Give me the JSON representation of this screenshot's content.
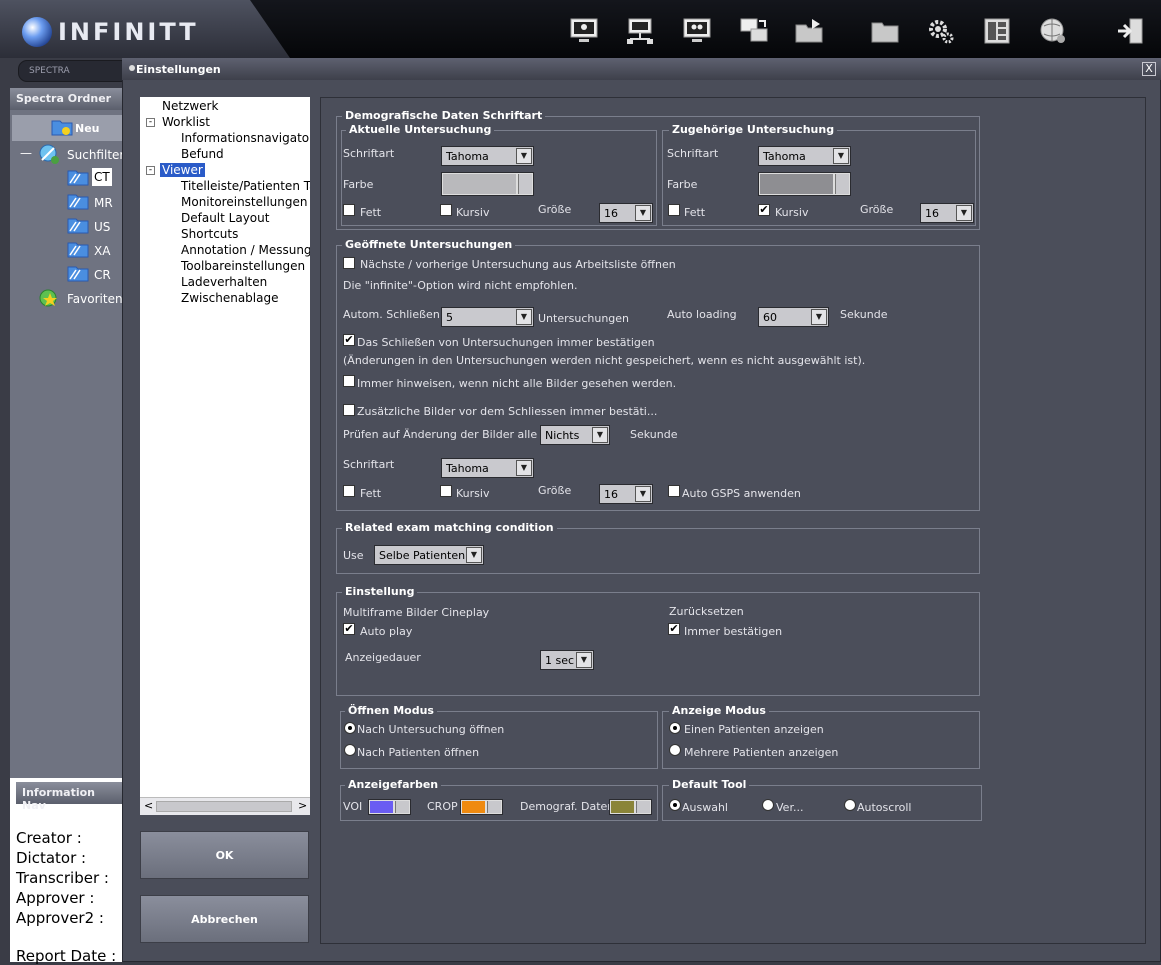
{
  "app": {
    "logo": "INFINITT",
    "search_placeholder": "SPECTRA"
  },
  "toolbar_icons": [
    "monitor-user-icon",
    "monitor-network-icon",
    "monitor-people-icon",
    "monitor-transfer-icon",
    "folder-open-arrow-icon",
    "folder-icon",
    "gear-icon",
    "layout-icon",
    "globe-icon",
    "exit-icon"
  ],
  "left_panel": {
    "title": "Spectra Ordner",
    "items": [
      {
        "label": "Neu"
      },
      {
        "label": "Suchfilter"
      },
      {
        "label": "CT"
      },
      {
        "label": "MR"
      },
      {
        "label": "US"
      },
      {
        "label": "XA"
      },
      {
        "label": "CR"
      },
      {
        "label": "Favoriten"
      }
    ],
    "collapse_symbol": "—"
  },
  "info_panel": {
    "title": "Information Nav",
    "lines": [
      "Creator :",
      "Dictator :",
      "Transcriber :",
      "Approver :",
      "Approver2 :",
      "Report Date :"
    ]
  },
  "dialog": {
    "title": "Einstellungen",
    "close": "X",
    "ok": "OK",
    "cancel": "Abbrechen",
    "nav": {
      "netzwerk": "Netzwerk",
      "worklist": "Worklist",
      "infonav": "Informationsnavigator",
      "befund": "Befund",
      "viewer": "Viewer",
      "titelleiste": "Titelleiste/Patienten Ta",
      "monitor": "Monitoreinstellungen",
      "layout": "Default Layout",
      "shortcuts": "Shortcuts",
      "annotation": "Annotation / Messung",
      "toolbar": "Toolbareinstellungen",
      "laden": "Ladeverhalten",
      "zwischen": "Zwischenablage",
      "expanded": "-",
      "scroll_left": "<",
      "scroll_right": ">"
    }
  },
  "demo": {
    "title": "Demografische Daten Schriftart",
    "current": {
      "title": "Aktuelle Untersuchung",
      "font_label": "Schriftart",
      "font": "Tahoma",
      "color_label": "Farbe",
      "bold": "Fett",
      "italic": "Kursiv",
      "size_label": "Größe",
      "size": "16",
      "bold_checked": false,
      "italic_checked": false
    },
    "related": {
      "title": "Zugehörige Untersuchung",
      "font_label": "Schriftart",
      "font": "Tahoma",
      "color_label": "Farbe",
      "bold": "Fett",
      "italic": "Kursiv",
      "size_label": "Größe",
      "size": "16",
      "bold_checked": false,
      "italic_checked": true
    }
  },
  "opened": {
    "title": "Geöffnete Untersuchungen",
    "next_prev": "Nächste / vorherige Untersuchung aus Arbeitsliste öffnen",
    "infinite_note": "Die \"infinite\"-Option wird nicht empfohlen.",
    "auto_close_label": "Autom. Schließen",
    "auto_close_value": "5",
    "auto_close_unit": "Untersuchungen",
    "auto_loading_label": "Auto loading",
    "auto_loading_value": "60",
    "auto_loading_unit": "Sekunde",
    "confirm_close": "Das Schließen von Untersuchungen immer bestätigen",
    "confirm_note": "(Änderungen in den Untersuchungen werden nicht gespeichert, wenn es nicht ausgewählt ist).",
    "notify_unseen": "Immer hinweisen, wenn nicht alle Bilder gesehen  werden.",
    "extra_images": "Zusätzliche Bilder vor dem Schliessen immer bestäti...",
    "check_label": "Prüfen auf Änderung der Bilder alle",
    "check_value": "Nichts",
    "check_unit": "Sekunde",
    "font_label": "Schriftart",
    "font": "Tahoma",
    "bold": "Fett",
    "italic": "Kursiv",
    "size_label": "Größe",
    "size": "16",
    "gsps": "Auto GSPS anwenden"
  },
  "related_exam": {
    "title": "Related exam matching condition",
    "use_label": "Use",
    "use_value": "Selbe Patienten..."
  },
  "einstellung": {
    "title": "Einstellung",
    "cine_label": "Multiframe Bilder Cineplay",
    "autoplay": "Auto play",
    "reset_label": "Zurücksetzen",
    "always_confirm": "Immer bestätigen",
    "duration_label": "Anzeigedauer",
    "duration_value": "1 sec"
  },
  "open_mode": {
    "title": "Öffnen Modus",
    "opt1": "Nach Untersuchung öffnen",
    "opt2": "Nach Patienten öffnen"
  },
  "display_mode": {
    "title": "Anzeige Modus",
    "opt1": "Einen Patienten anzeigen",
    "opt2": "Mehrere Patienten anzeigen"
  },
  "colors": {
    "title": "Anzeigefarben",
    "voi": "VOI",
    "crop": "CROP",
    "demo": "Demograf. Daten",
    "voi_color": "#6a5cf2",
    "crop_color": "#ef8a10",
    "demo_color": "#8a8438",
    "current_color": "#b9b9bc",
    "related_color": "#8e8e92"
  },
  "default_tool": {
    "title": "Default Tool",
    "opt1": "Auswahl",
    "opt2": "Ver...",
    "opt3": "Autoscroll"
  },
  "arrow": "▼"
}
